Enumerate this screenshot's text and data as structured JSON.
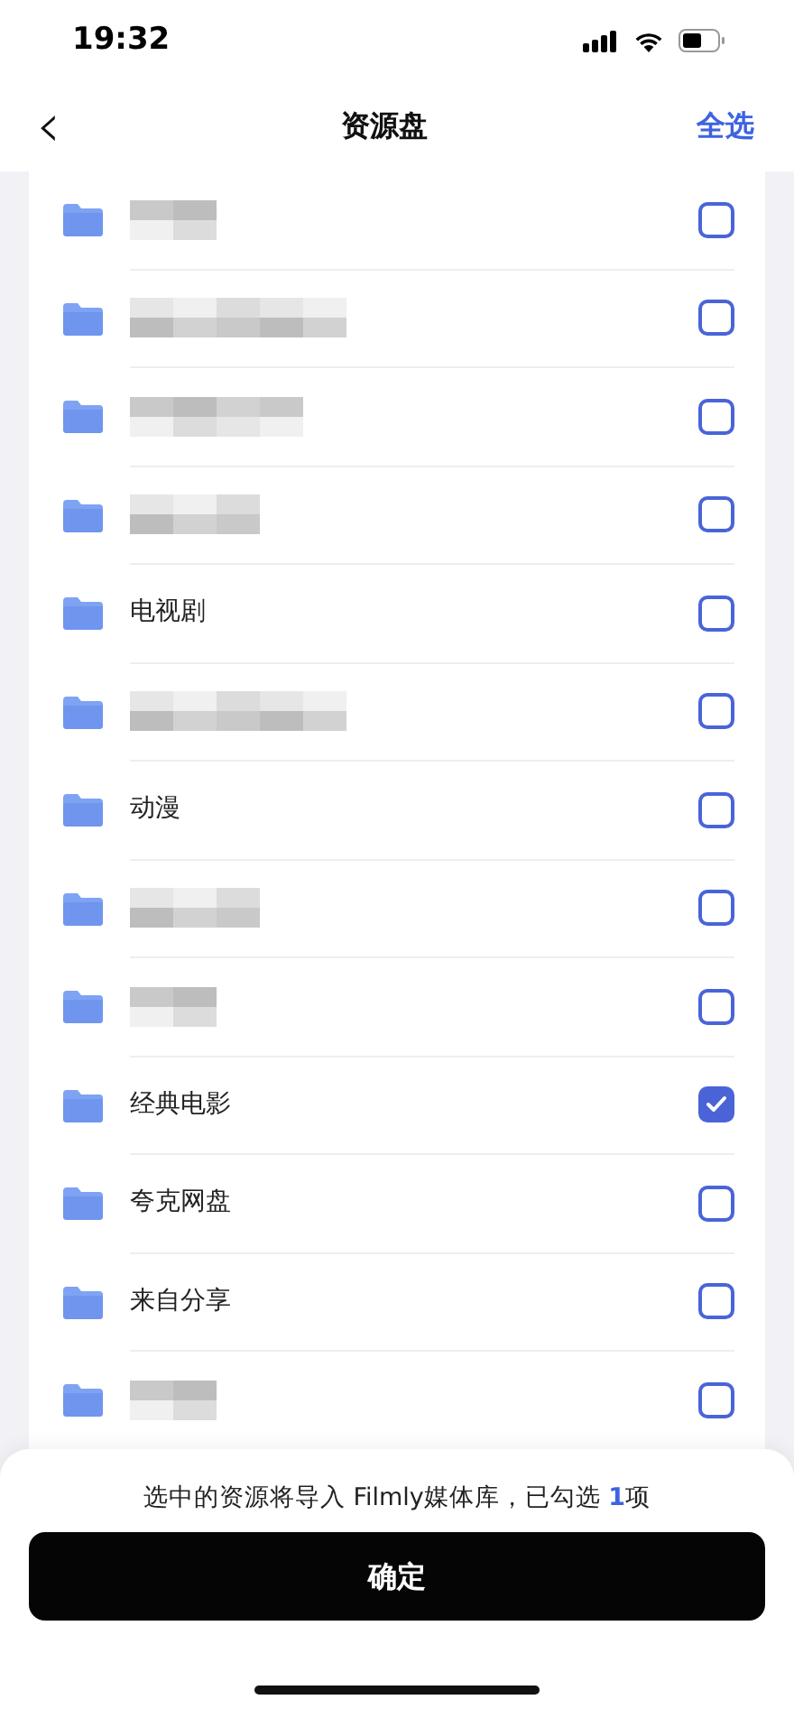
{
  "status_bar": {
    "time": "19:32"
  },
  "nav": {
    "back": "‹",
    "title": "资源盘",
    "action": "全选"
  },
  "folders": [
    {
      "kind": "blurred",
      "checked": false
    },
    {
      "kind": "blurred",
      "checked": false
    },
    {
      "kind": "blurred",
      "checked": false
    },
    {
      "kind": "blurred",
      "checked": false
    },
    {
      "kind": "named",
      "name": "电视剧",
      "checked": false
    },
    {
      "kind": "blurred",
      "checked": false
    },
    {
      "kind": "named",
      "name": "动漫",
      "checked": false
    },
    {
      "kind": "blurred",
      "checked": false
    },
    {
      "kind": "blurred",
      "checked": false
    },
    {
      "kind": "named",
      "name": "经典电影",
      "checked": true
    },
    {
      "kind": "named",
      "name": "夸克网盘",
      "checked": false
    },
    {
      "kind": "named",
      "name": "来自分享",
      "checked": false
    },
    {
      "kind": "blurred",
      "checked": false
    }
  ],
  "footer": {
    "prefix": "选中的资源将导入 Filmly媒体库，已勾选 ",
    "count": "1",
    "suffix": "项",
    "confirm": "确定"
  }
}
